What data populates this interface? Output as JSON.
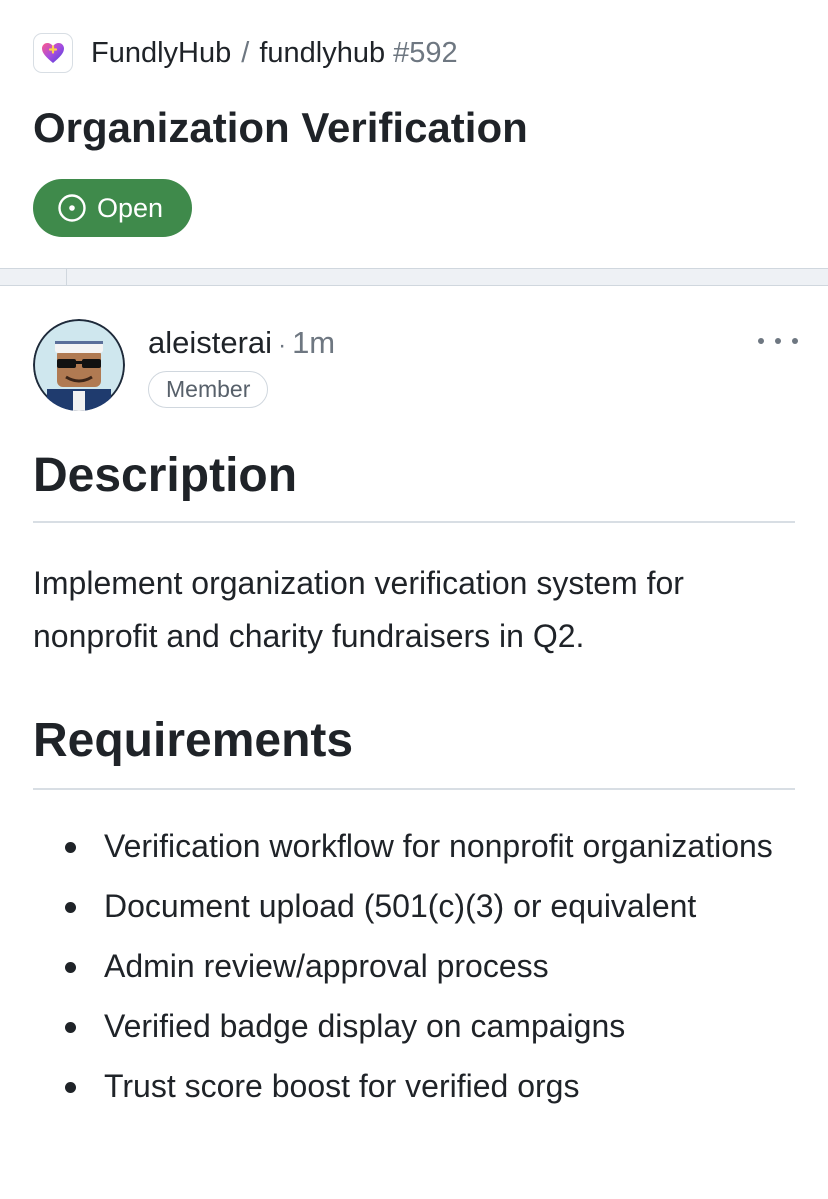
{
  "header": {
    "app_icon": "heart-app-icon",
    "owner": "FundlyHub",
    "separator": "/",
    "repo": "fundlyhub",
    "issue_number": "#592",
    "title": "Organization Verification",
    "state_icon": "issue-open-icon",
    "state": "Open",
    "state_color": "#3f8a4b"
  },
  "comment": {
    "author": "aleisterai",
    "separator": "·",
    "time": "1m",
    "role": "Member",
    "more_icon": "ellipsis-icon",
    "body": {
      "description_heading": "Description",
      "description_text": "Implement organization verification system for nonprofit and charity fundraisers in Q2.",
      "requirements_heading": "Requirements",
      "requirements": [
        "Verification workflow for nonprofit organizations",
        "Document upload (501(c)(3) or equivalent",
        "Admin review/approval process",
        "Verified badge display on campaigns",
        "Trust score boost for verified orgs"
      ]
    }
  }
}
